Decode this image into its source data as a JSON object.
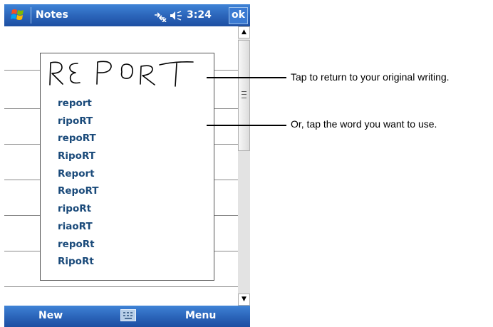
{
  "titlebar": {
    "app_title": "Notes",
    "time": "3:24",
    "ok_label": "ok"
  },
  "popup": {
    "candidates": [
      "report",
      "ripoRT",
      "repoRT",
      "RipoRT",
      "Report",
      "RepoRT",
      "ripoRt",
      "riaoRT",
      "repoRt",
      "RipoRt"
    ]
  },
  "menubar": {
    "left_label": "New",
    "right_label": "Menu"
  },
  "callouts": {
    "first": "Tap to return to your original writing.",
    "second": "Or, tap the word you want to use."
  },
  "icons": {
    "start": "windows-flag-icon",
    "connectivity": "connectivity-icon",
    "volume": "volume-icon",
    "keyboard": "keyboard-icon"
  }
}
